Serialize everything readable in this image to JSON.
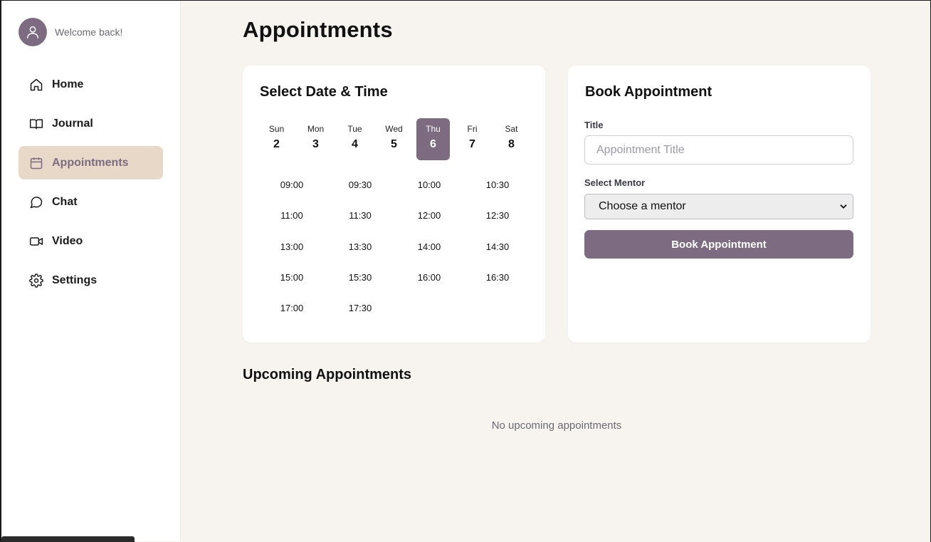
{
  "sidebar": {
    "welcome": "Welcome back!",
    "items": [
      {
        "label": "Home",
        "icon": "home-icon",
        "active": false
      },
      {
        "label": "Journal",
        "icon": "book-icon",
        "active": false
      },
      {
        "label": "Appointments",
        "icon": "calendar-icon",
        "active": true
      },
      {
        "label": "Chat",
        "icon": "chat-icon",
        "active": false
      },
      {
        "label": "Video",
        "icon": "video-icon",
        "active": false
      },
      {
        "label": "Settings",
        "icon": "gear-icon",
        "active": false
      }
    ]
  },
  "page": {
    "title": "Appointments"
  },
  "date_time": {
    "title": "Select Date & Time",
    "days": [
      {
        "name": "Sun",
        "num": "2"
      },
      {
        "name": "Mon",
        "num": "3"
      },
      {
        "name": "Tue",
        "num": "4"
      },
      {
        "name": "Wed",
        "num": "5"
      },
      {
        "name": "Thu",
        "num": "6"
      },
      {
        "name": "Fri",
        "num": "7"
      },
      {
        "name": "Sat",
        "num": "8"
      }
    ],
    "selected_day": "Thu",
    "times": [
      "09:00",
      "09:30",
      "10:00",
      "10:30",
      "11:00",
      "11:30",
      "12:00",
      "12:30",
      "13:00",
      "13:30",
      "14:00",
      "14:30",
      "15:00",
      "15:30",
      "16:00",
      "16:30",
      "17:00",
      "17:30"
    ]
  },
  "booking": {
    "title": "Book Appointment",
    "title_label": "Title",
    "title_placeholder": "Appointment Title",
    "title_value": "",
    "mentor_label": "Select Mentor",
    "mentor_selected": "Choose a mentor",
    "button_label": "Book Appointment"
  },
  "upcoming": {
    "title": "Upcoming Appointments",
    "empty_text": "No upcoming appointments"
  },
  "colors": {
    "accent": "#7d6b81",
    "active_nav_bg": "#e8d8c8",
    "page_bg": "#f7f4f0"
  }
}
